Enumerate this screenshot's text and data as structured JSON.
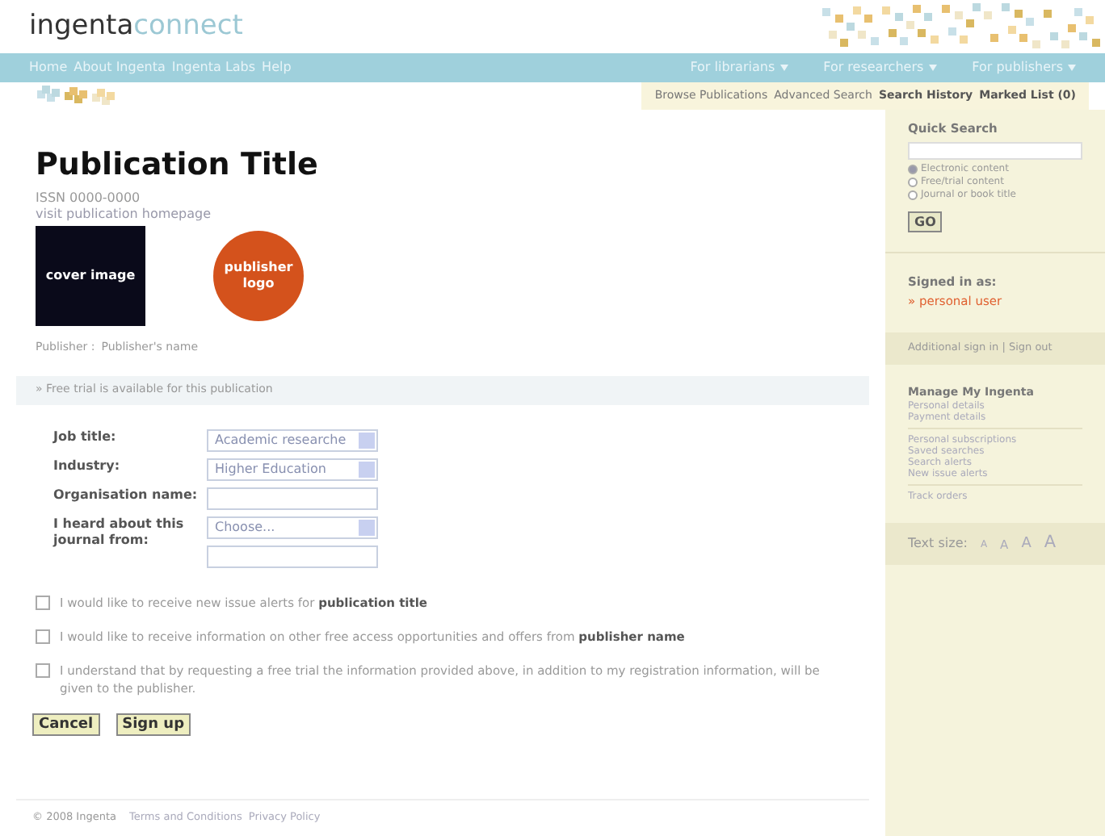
{
  "logo": {
    "main": "ingenta",
    "accent": "connect"
  },
  "nav": {
    "links": [
      "Home",
      "About Ingenta",
      "Ingenta Labs",
      "Help"
    ],
    "menus": [
      "For librarians",
      "For researchers",
      "For publishers"
    ]
  },
  "subnav": [
    {
      "label": "Browse Publications",
      "bold": false
    },
    {
      "label": "Advanced Search",
      "bold": false
    },
    {
      "label": "Search History",
      "bold": true
    },
    {
      "label": "Marked List (0)",
      "bold": true
    }
  ],
  "publication": {
    "title": "Publication Title",
    "issn": "ISSN 0000-0000",
    "homepage_link": "visit publication homepage",
    "cover_label": "cover image",
    "publisher_logo": "publisher logo",
    "publisher_label": "Publisher :",
    "publisher_name": "Publisher's name"
  },
  "trial_notice": "» Free trial is available for this publication",
  "form": [
    {
      "kind": "select",
      "label": "Job title:",
      "value": "Academic researche"
    },
    {
      "kind": "select",
      "label": "Industry:",
      "value": "Higher Education"
    },
    {
      "kind": "text",
      "label": "Organisation name:"
    },
    {
      "kind": "select_text",
      "label": "I heard about this journal from:",
      "value": "Choose..."
    }
  ],
  "consents": [
    {
      "text": "I would like to receive new issue alerts for **publication title**",
      "checked": false
    },
    {
      "text": "I would like to receive information on other free access opportunities and offers from **publisher name**",
      "checked": false
    },
    {
      "text": "I understand that by requesting a free trial the information provided above, in addition to my registration information, will be given to the publisher.",
      "checked": false
    }
  ],
  "buttons": [
    "Cancel",
    "Sign up"
  ],
  "footer": {
    "copyright": "© 2008 Ingenta",
    "links": [
      "Terms and Conditions",
      "Privacy Policy"
    ]
  },
  "sidebar": {
    "quick_search": {
      "title": "Quick Search",
      "go": "GO",
      "options": [
        {
          "label": "Electronic content",
          "selected": true
        },
        {
          "label": "Free/trial content",
          "selected": false
        },
        {
          "label": "Journal or book title",
          "selected": false
        }
      ]
    },
    "signed_in_label": "Signed in as:",
    "user": "» personal user",
    "account_links": "Additional sign in | Sign out",
    "manage_title": "Manage My Ingenta",
    "manage_groups": [
      [
        "Personal details",
        "Payment details"
      ],
      [
        "Personal subscriptions",
        "Saved searches",
        "Search alerts",
        "New issue alerts"
      ],
      [
        "Track orders"
      ]
    ],
    "text_size_label": "Text size:",
    "text_sizes": [
      "A",
      "A",
      "A",
      "A"
    ]
  }
}
